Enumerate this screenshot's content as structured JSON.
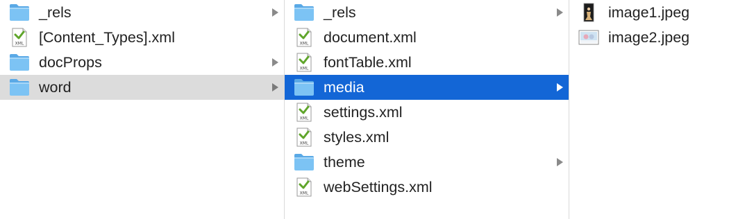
{
  "columns": [
    {
      "items": [
        {
          "label": "_rels",
          "icon": "folder-icon",
          "kind": "folder",
          "chevron": true,
          "state": "none"
        },
        {
          "label": "[Content_Types].xml",
          "icon": "xml-file-icon",
          "kind": "xml",
          "chevron": false,
          "state": "none"
        },
        {
          "label": "docProps",
          "icon": "folder-icon",
          "kind": "folder",
          "chevron": true,
          "state": "none"
        },
        {
          "label": "word",
          "icon": "folder-icon",
          "kind": "folder",
          "chevron": true,
          "state": "inactive-selected"
        }
      ]
    },
    {
      "items": [
        {
          "label": "_rels",
          "icon": "folder-icon",
          "kind": "folder",
          "chevron": true,
          "state": "none"
        },
        {
          "label": "document.xml",
          "icon": "xml-file-icon",
          "kind": "xml",
          "chevron": false,
          "state": "none"
        },
        {
          "label": "fontTable.xml",
          "icon": "xml-file-icon",
          "kind": "xml",
          "chevron": false,
          "state": "none"
        },
        {
          "label": "media",
          "icon": "folder-icon",
          "kind": "folder",
          "chevron": true,
          "state": "selected"
        },
        {
          "label": "settings.xml",
          "icon": "xml-file-icon",
          "kind": "xml",
          "chevron": false,
          "state": "none"
        },
        {
          "label": "styles.xml",
          "icon": "xml-file-icon",
          "kind": "xml",
          "chevron": false,
          "state": "none"
        },
        {
          "label": "theme",
          "icon": "folder-icon",
          "kind": "folder",
          "chevron": true,
          "state": "none"
        },
        {
          "label": "webSettings.xml",
          "icon": "xml-file-icon",
          "kind": "xml",
          "chevron": false,
          "state": "none"
        }
      ]
    },
    {
      "items": [
        {
          "label": "image1.jpeg",
          "icon": "image-thumbnail-icon",
          "kind": "img1",
          "chevron": false,
          "state": "none"
        },
        {
          "label": "image2.jpeg",
          "icon": "image-thumbnail-icon",
          "kind": "img2",
          "chevron": false,
          "state": "none"
        }
      ]
    }
  ],
  "colors": {
    "selection": "#1366d6",
    "inactive_selection": "#dcdcdc",
    "folder": "#68b8ef",
    "xml_badge_green": "#5fa52a"
  }
}
